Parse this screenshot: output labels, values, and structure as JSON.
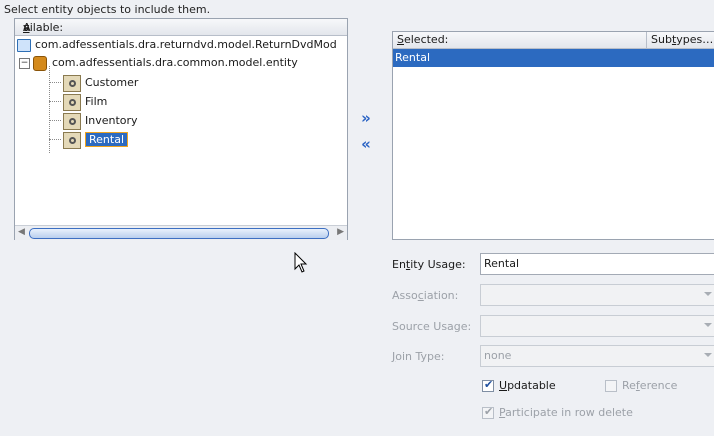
{
  "instruction": "Select entity objects to include them.",
  "available": {
    "header_prefix": "A",
    "header_mnemonic": "v",
    "header_suffix": "ailable:",
    "root_item": "com.adfessentials.dra.returndvd.model.ReturnDvdMod",
    "package": "com.adfessentials.dra.common.model.entity",
    "entities": [
      "Customer",
      "Film",
      "Inventory",
      "Rental"
    ],
    "selected_entity": "Rental"
  },
  "shuttle": {
    "add_glyph": "»",
    "remove_glyph": "«"
  },
  "selected": {
    "header_mnemonic": "S",
    "header_suffix": "elected:",
    "subtypes_prefix": "Sub",
    "subtypes_mnemonic": "t",
    "subtypes_suffix": "ypes…",
    "items": [
      "Rental"
    ]
  },
  "form": {
    "entity_usage_label_pre": "En",
    "entity_usage_label_mn": "t",
    "entity_usage_label_post": "ity Usage:",
    "entity_usage_value": "Rental",
    "association_label_pre": "Asso",
    "association_label_mn": "c",
    "association_label_post": "iation:",
    "association_value": "",
    "source_usage_label": "Source Usage:",
    "source_usage_value": "",
    "join_type_label_mn": "J",
    "join_type_label_post": "oin Type:",
    "join_type_value": "none",
    "updatable_mn": "U",
    "updatable_post": "pdatable",
    "updatable_checked": true,
    "reference_pre": "Re",
    "reference_mn": "f",
    "reference_post": "erence",
    "reference_checked": false,
    "participate_mn": "P",
    "participate_post": "articipate in row delete",
    "participate_checked": true
  },
  "icons": {
    "folder": "folder-icon",
    "jar": "jar-icon",
    "entity": "entity-object-icon",
    "cursor": "mouse-pointer-icon"
  },
  "colors": {
    "selection": "#2c6ac0",
    "focus_border": "#f0a41e",
    "shuttle": "#2a63c4"
  }
}
